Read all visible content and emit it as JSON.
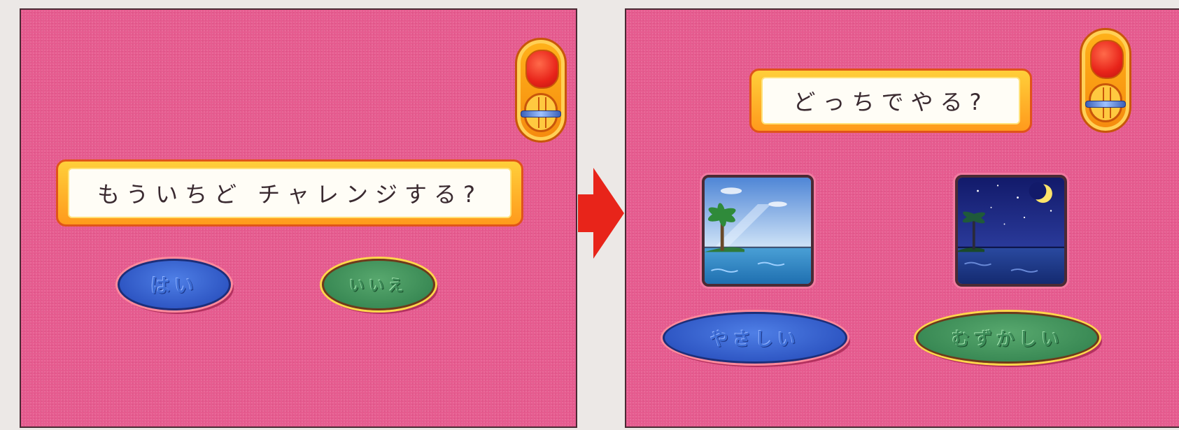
{
  "left_screen": {
    "message": "もういちど チャレンジする?",
    "buttons": {
      "yes_label": "はい",
      "no_label": "いいえ"
    }
  },
  "right_screen": {
    "message": "どっちでやる?",
    "scenes": [
      {
        "icon": "day-beach-scene"
      },
      {
        "icon": "night-beach-scene"
      }
    ],
    "buttons": {
      "easy_label": "やさしい",
      "hard_label": "むずかしい"
    }
  },
  "transition_icon": "right-arrow-icon",
  "colors": {
    "background_pink": "#e65b8f",
    "banner_orange": "#ff9a1c",
    "button_blue": "#2f57c4",
    "button_green": "#3a8a55",
    "arrow_red": "#e8241a",
    "lamp_red": "#e8241a"
  }
}
